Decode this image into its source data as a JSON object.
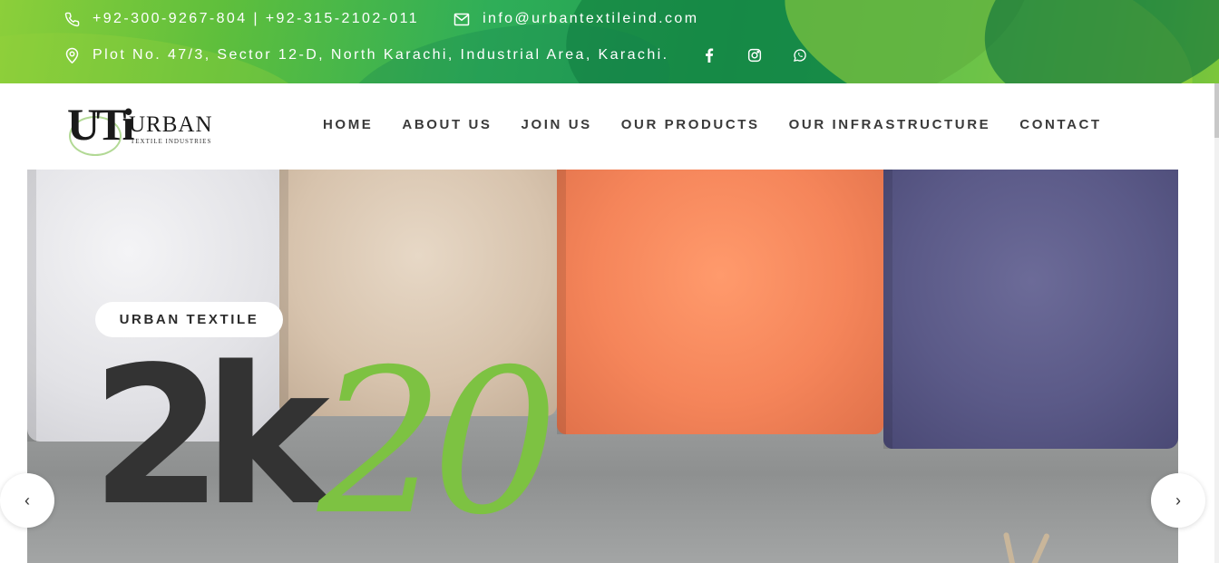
{
  "topbar": {
    "phones": "+92-300-9267-804 | +92-315-2102-011",
    "email": "info@urbantextileind.com",
    "address": "Plot No. 47/3, Sector 12-D, North Karachi, Industrial Area, Karachi.",
    "icons": [
      "phone-icon",
      "mail-icon",
      "location-icon",
      "facebook-icon",
      "instagram-icon",
      "whatsapp-icon"
    ]
  },
  "logo": {
    "mark": "UTi",
    "word": "URBAN",
    "sub": "TEXTILE INDUSTRIES"
  },
  "nav": [
    {
      "label": "HOME"
    },
    {
      "label": "ABOUT US"
    },
    {
      "label": "JOIN US"
    },
    {
      "label": "OUR PRODUCTS"
    },
    {
      "label": "OUR INFRASTRUCTURE"
    },
    {
      "label": "CONTACT"
    }
  ],
  "hero": {
    "badge": "URBAN TEXTILE",
    "headline_dark": "2k",
    "headline_green": "20",
    "prev": "‹",
    "next": "›"
  },
  "colors": {
    "brand_green": "#7dc242",
    "dark_text": "#333333",
    "topbar_green": "#2fae58"
  }
}
